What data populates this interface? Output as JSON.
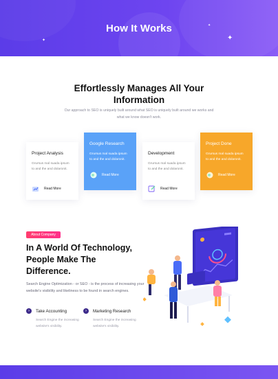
{
  "hero": {
    "title": "How It Works"
  },
  "intro": {
    "title_line1": "Effortlessly Manages All Your",
    "title_line2": "Information",
    "desc": "Our approach to SEO is uniquely built around what SEO is uniquely built around we works and what we know doesn't work."
  },
  "cards": [
    {
      "title": "Project Analysis",
      "text": "Grursus mal suada ipsum to and the and dolaronit.",
      "link": "Read More",
      "icon": "analysis-icon"
    },
    {
      "title": "Google Research",
      "text": "Grursus mal suada ipsum to and the and dolaronit.",
      "link": "Read More",
      "icon": "research-icon"
    },
    {
      "title": "Development",
      "text": "Grursus mal suada ipsum to and the and dolaronit.",
      "link": "Read More",
      "icon": "edit-icon"
    },
    {
      "title": "Project Done",
      "text": "Grursus mal suada ipsum to and the and dolaronit.",
      "link": "Read More",
      "icon": "done-icon"
    }
  ],
  "about": {
    "badge": "About Company",
    "title_line1": "In A World Of Technology,",
    "title_line2": "People Make The",
    "title_line3": "Difference.",
    "desc": "Search Engine Optimization - or SEO - is the process of increasing your website's visibility and likeliness to be found in search engines.",
    "features": [
      {
        "title": "Take Accounting",
        "text": "Search Engine the increasing website's visibility."
      },
      {
        "title": "Marketing Research",
        "text": "Search Engine the increasing website's visibility."
      }
    ]
  },
  "colors": {
    "hero": "#5b3ce8",
    "card_blue": "#5aa2f8",
    "card_orange": "#f7a72a",
    "badge": "#ff3d6e"
  }
}
